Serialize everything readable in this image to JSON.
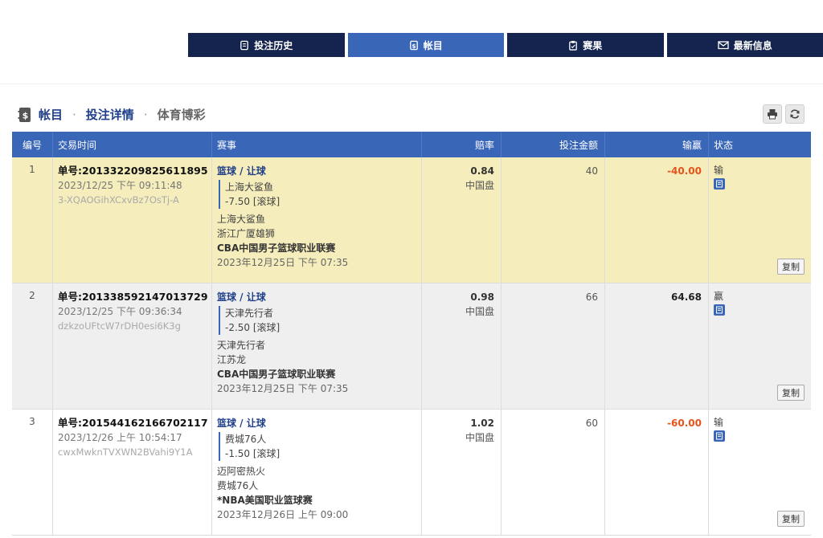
{
  "nav": [
    {
      "label": "投注历史",
      "icon": "document-icon",
      "active": false
    },
    {
      "label": "帐目",
      "icon": "ledger-icon",
      "active": true
    },
    {
      "label": "赛果",
      "icon": "clipboard-icon",
      "active": false
    },
    {
      "label": "最新信息",
      "icon": "mail-icon",
      "active": false
    }
  ],
  "breadcrumb": {
    "c1": "帐目",
    "c2": "投注详情",
    "c3": "体育博彩",
    "sep": "·"
  },
  "table": {
    "headers": {
      "no": "编号",
      "time": "交易时间",
      "event": "赛事",
      "odds": "赔率",
      "amount": "投注金额",
      "winloss": "输赢",
      "status": "状态"
    },
    "copy_label": "复制",
    "rows": [
      {
        "no": "1",
        "order_id": "单号:201332209825611895",
        "time": "2023/12/25 下午 09:11:48",
        "code": "3-XQAOGihXCxvBz7OsTj-A",
        "sport": "篮球 / 让球",
        "pick": "上海大鲨鱼",
        "line": "-7.50 [滚球]",
        "team1": "上海大鲨鱼",
        "team2": "浙江广厦雄狮",
        "league": "CBA中国男子篮球职业联赛",
        "match_date": "2023年12月25日 下午 07:35",
        "odds": "0.84",
        "odds_type": "中国盘",
        "amount": "40",
        "winloss": "-40.00",
        "status": "输"
      },
      {
        "no": "2",
        "order_id": "单号:201338592147013729",
        "time": "2023/12/25 下午 09:36:34",
        "code": "dzkzoUFtcW7rDH0esi6K3g",
        "sport": "篮球 / 让球",
        "pick": "天津先行者",
        "line": "-2.50 [滚球]",
        "team1": "天津先行者",
        "team2": "江苏龙",
        "league": "CBA中国男子篮球职业联赛",
        "match_date": "2023年12月25日 下午 07:35",
        "odds": "0.98",
        "odds_type": "中国盘",
        "amount": "66",
        "winloss": "64.68",
        "status": "赢"
      },
      {
        "no": "3",
        "order_id": "单号:201544162166702117",
        "time": "2023/12/26 上午 10:54:17",
        "code": "cwxMwknTVXWN2BVahi9Y1A",
        "sport": "篮球 / 让球",
        "pick": "费城76人",
        "line": "-1.50 [滚球]",
        "team1": "迈阿密热火",
        "team2": "费城76人",
        "league": "*NBA美国职业篮球赛",
        "match_date": "2023年12月26日 上午 09:00",
        "odds": "1.02",
        "odds_type": "中国盘",
        "amount": "60",
        "winloss": "-60.00",
        "status": "输"
      }
    ]
  },
  "colors": {
    "nav_bg": "#14244e",
    "nav_active": "#3a66b8",
    "header_bg": "#3a66b8",
    "row1_bg": "#f5edbb",
    "row2_bg": "#efefef",
    "loss": "#e4541b"
  }
}
